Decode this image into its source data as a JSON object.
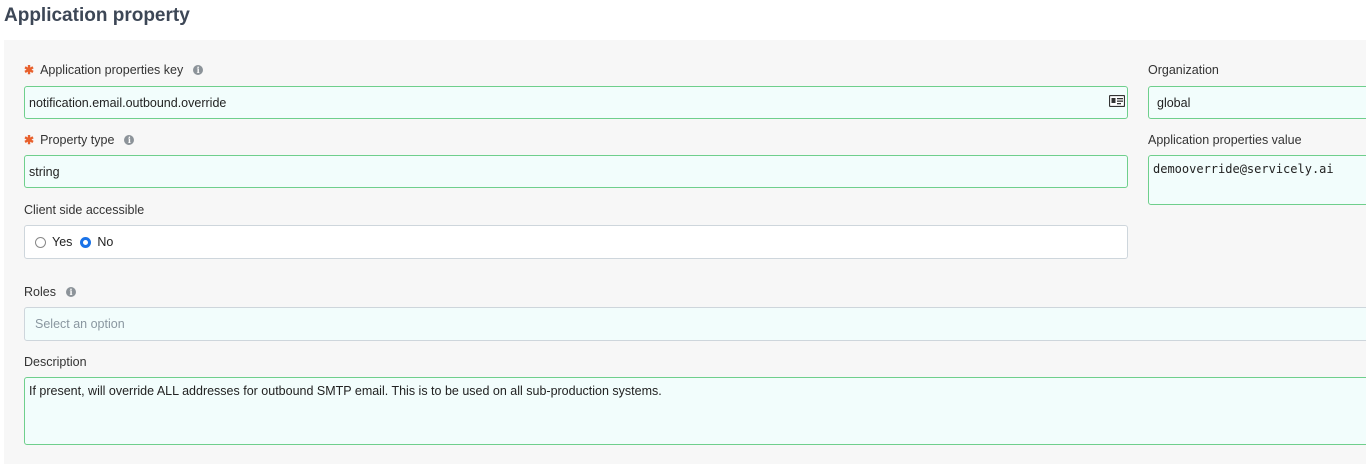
{
  "page": {
    "title": "Application property"
  },
  "form": {
    "key": {
      "label": "Application properties key",
      "value": "notification.email.outbound.override"
    },
    "organization": {
      "label": "Organization",
      "value": "global"
    },
    "property_type": {
      "label": "Property type",
      "value": "string"
    },
    "properties_value": {
      "label": "Application properties value",
      "value": "demooverride@servicely.ai"
    },
    "client_side": {
      "label": "Client side accessible",
      "options": [
        {
          "label": "Yes",
          "checked": false
        },
        {
          "label": "No",
          "checked": true
        }
      ]
    },
    "roles": {
      "label": "Roles",
      "placeholder": "Select an option"
    },
    "description": {
      "label": "Description",
      "value": "If present, will override ALL addresses for outbound SMTP email. This is to be used on all sub-production systems."
    },
    "required_marker": "✱",
    "info_glyph": "i"
  },
  "icons": {
    "info": "info-icon",
    "card": "contact-card-icon"
  },
  "colors": {
    "accent_border": "#6fcf8c",
    "field_bg": "#f2fdfc",
    "required": "#e8602c",
    "radio": "#1a73e8"
  }
}
